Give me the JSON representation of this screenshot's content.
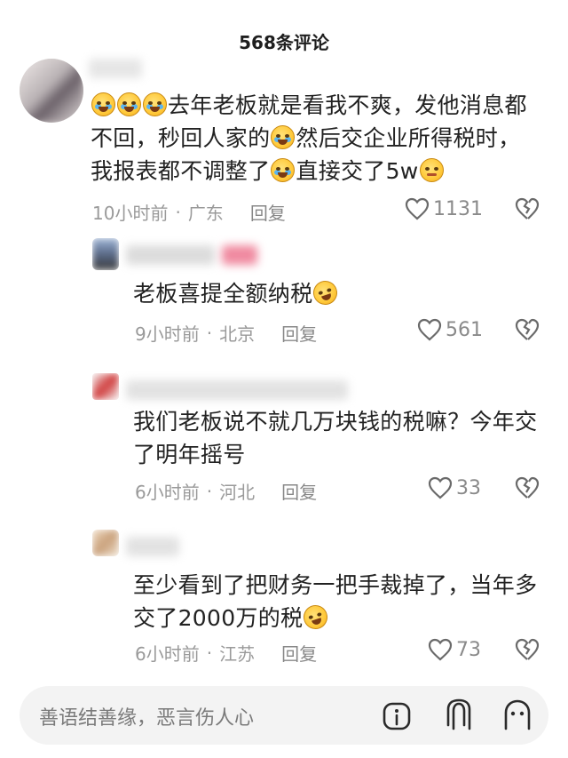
{
  "header": {
    "title": "568条评论"
  },
  "comments": [
    {
      "segments": [
        "去年老板就是看我不爽，发他消息都",
        "不回，秒回人家的",
        "然后交企业所得税时，",
        "我报表都不调整了",
        "直接交了5w"
      ],
      "time": "10小时前",
      "location": "广东",
      "reply": "回复",
      "likes": "1131"
    },
    {
      "segments": [
        "老板喜提全额纳税"
      ],
      "time": "9小时前",
      "location": "北京",
      "reply": "回复",
      "likes": "561"
    },
    {
      "segments": [
        "我们老板说不就几万块钱的税嘛？今年交",
        "了明年摇号"
      ],
      "time": "6小时前",
      "location": "河北",
      "reply": "回复",
      "likes": "33"
    },
    {
      "segments": [
        "至少看到了把财务一把手裁掉了，当年多",
        "交了2000万的税"
      ],
      "time": "6小时前",
      "location": "江苏",
      "reply": "回复",
      "likes": "73"
    }
  ],
  "input": {
    "placeholder": "善语结善缘，恶言伤人心"
  },
  "separator": "·",
  "icons": [
    "heart-icon",
    "broken-heart-icon",
    "at-icon",
    "image-icon",
    "emoji-icon"
  ]
}
